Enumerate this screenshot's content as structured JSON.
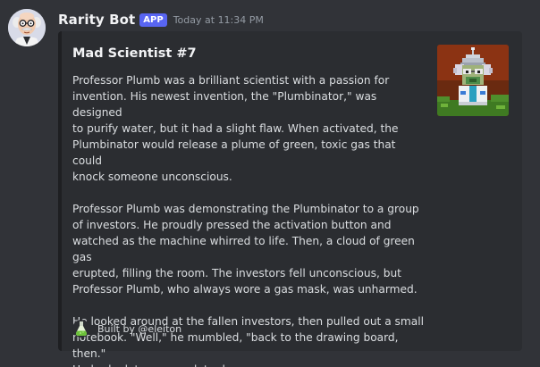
{
  "author": {
    "name": "Rarity Bot",
    "badge": "APP",
    "timestamp": "Today at 11:34 PM",
    "avatar_icon": "scientist-avatar-icon"
  },
  "embed": {
    "title": "Mad Scientist #7",
    "paragraphs": [
      "Professor Plumb was a brilliant scientist with a passion for\ninvention. His newest invention, the \"Plumbinator,\" was designed\nto purify water, but it had a slight flaw. When activated, the\nPlumbinator would release a plume of green, toxic gas that could\nknock someone unconscious.",
      "Professor Plumb was demonstrating the Plumbinator to a group\nof investors. He proudly pressed the activation button and\nwatched as the machine whirred to life. Then, a cloud of green gas\nerupted, filling the room. The investors fell unconscious, but\nProfessor Plumb, who always wore a gas mask, was unharmed.",
      "He looked around at the fallen investors, then pulled out a small\nnotebook. \"Well,\" he mumbled, \"back to the drawing board, then.\"\nHe had a lot more work to do."
    ],
    "thumbnail_icon": "pixel-scientist-nft-image",
    "footer": {
      "text": "Built by @eleiton",
      "icon": "green-potion-flask-icon"
    }
  },
  "colors": {
    "background": "#313338",
    "embed_background": "#2b2d31",
    "app_badge": "#5865f2"
  }
}
